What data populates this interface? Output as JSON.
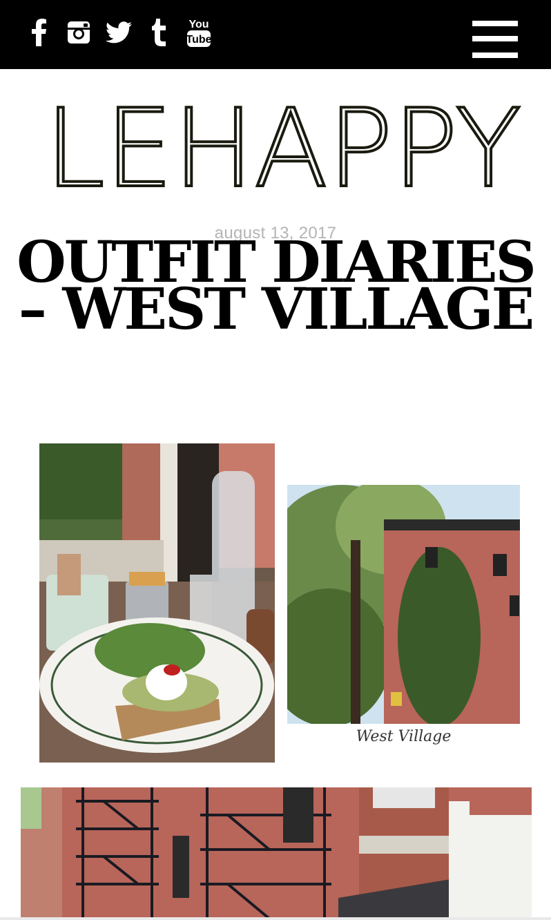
{
  "social": {
    "icons": [
      "facebook-icon",
      "instagram-icon",
      "twitter-icon",
      "tumblr-icon",
      "youtube-icon"
    ],
    "youtube_label_top": "You",
    "youtube_label_bottom": "Tube"
  },
  "menu": {
    "icon": "hamburger-menu-icon"
  },
  "logo": {
    "text": "LEHAPPY"
  },
  "post": {
    "date": "august 13, 2017",
    "title": "OUTFIT DIARIES – WEST VILLAGE"
  },
  "images": {
    "village_caption": "West Village"
  },
  "colors": {
    "topbar": "#000000",
    "background": "#ffffff",
    "date_text": "#b4b4b4",
    "brick": "#b8655a"
  }
}
